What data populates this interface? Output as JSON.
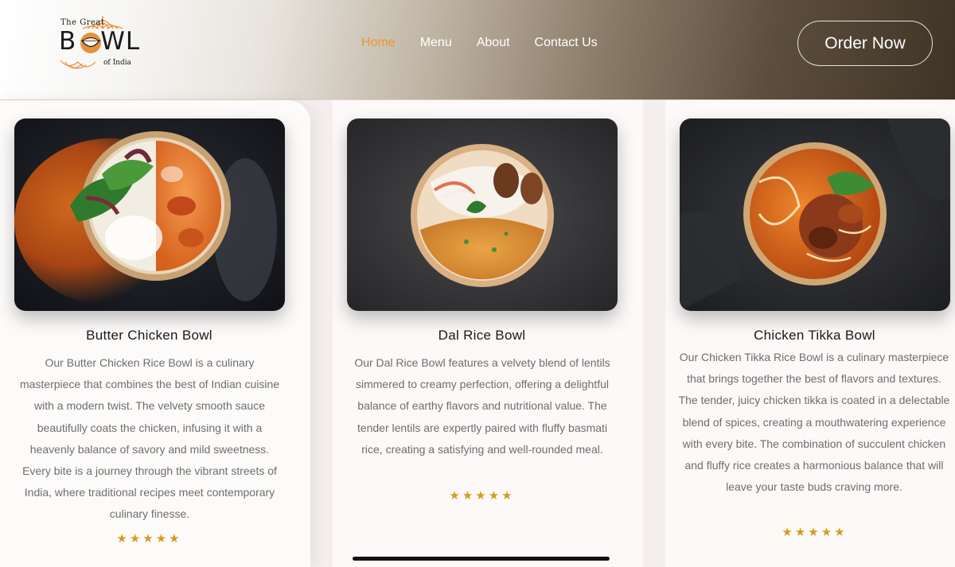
{
  "logo": {
    "line1": "The Great",
    "line2": "BOWL",
    "line3": "of India"
  },
  "nav": {
    "items": [
      {
        "label": "Home",
        "active": true
      },
      {
        "label": "Menu",
        "active": false
      },
      {
        "label": "About",
        "active": false
      },
      {
        "label": "Contact Us",
        "active": false
      }
    ]
  },
  "order_button": {
    "label": "Order Now"
  },
  "cards": [
    {
      "title": "Butter Chicken Bowl",
      "description": "Our Butter Chicken Rice Bowl is a culinary masterpiece that combines the best of Indian cuisine with a modern twist. The velvety smooth sauce beautifully coats the chicken, infusing it with a heavenly balance of savory and mild sweetness. Every bite is a journey through the vibrant streets of India, where traditional recipes meet contemporary culinary finesse.",
      "rating": 5,
      "stars": "★★★★★"
    },
    {
      "title": "Dal Rice Bowl",
      "description": "Our Dal Rice Bowl features a velvety blend of lentils simmered to creamy perfection, offering a delightful balance of earthy flavors and nutritional value. The tender lentils are expertly paired with fluffy basmati rice, creating a satisfying and well-rounded meal.",
      "rating": 5,
      "stars": "★★★★★"
    },
    {
      "title": "Chicken Tikka Bowl",
      "description": "Our Chicken Tikka Rice Bowl is a culinary masterpiece that brings together the best of flavors and textures. The tender, juicy chicken tikka is coated in a delectable blend of spices, creating a mouthwatering experience with every bite. The combination of succulent chicken and fluffy rice creates a harmonious balance that will leave your taste buds craving more.",
      "rating": 5,
      "stars": "★★★★★"
    }
  ],
  "colors": {
    "accent": "#e89a2a",
    "star": "#d59b1b",
    "text_body": "#6e6e6e",
    "text_title": "#1a1a1a"
  }
}
